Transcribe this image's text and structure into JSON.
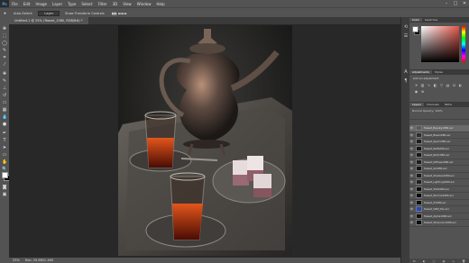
{
  "app": {
    "logo": "Ps"
  },
  "menu": [
    "File",
    "Edit",
    "Image",
    "Layer",
    "Type",
    "Select",
    "Filter",
    "3D",
    "View",
    "Window",
    "Help"
  ],
  "window_controls": [
    "–",
    "□",
    "✕"
  ],
  "options": {
    "tool": "Auto-Select:",
    "layer_value": "Layer",
    "show_transform": "Show Transform Controls"
  },
  "document": {
    "tab_title": "Untitled-1 @ 25% (Teaset_1080, RGB/8#) *"
  },
  "status": {
    "zoom": "25%",
    "doc_info": "Doc: 25.8M/1.16G"
  },
  "color_panel": {
    "tabs": [
      "Color",
      "Swatches"
    ],
    "fg": "#ffffff",
    "bg": "#000000",
    "accent": "#e2554a"
  },
  "adjustments": {
    "tabs": [
      "Adjustments",
      "Styles"
    ],
    "label": "Add an adjustment"
  },
  "layers_panel": {
    "tabs": [
      "Layers",
      "Channels",
      "Paths"
    ],
    "controls": "Normal   Opacity: 100%",
    "layers": [
      {
        "name": "Teaset_Beauty1080.exr",
        "thumb": "#5a5a5a",
        "selected": true
      },
      {
        "name": "Teaset_Base1080.exr",
        "thumb": "#2e2e2e",
        "selected": false
      },
      {
        "name": "Teaset_Spec1080.exr",
        "thumb": "#1f1f1f",
        "selected": false
      },
      {
        "name": "Teaset_Refl1080.exr",
        "thumb": "#181818",
        "selected": false
      },
      {
        "name": "Teaset_Refr1080.exr",
        "thumb": "#1a1a1a",
        "selected": false
      },
      {
        "name": "Teaset_Diffuse1080.exr",
        "thumb": "#202020",
        "selected": false
      },
      {
        "name": "Teaset_GI1080.exr",
        "thumb": "#161616",
        "selected": false
      },
      {
        "name": "Teaset_Shadow1080.exr",
        "thumb": "#1c1c1c",
        "selected": false
      },
      {
        "name": "Teaset_Lighting1080.exr",
        "thumb": "#222222",
        "selected": false
      },
      {
        "name": "Teaset_SSS1080.exr",
        "thumb": "#0e0e0e",
        "selected": false
      },
      {
        "name": "Teaset_Normal1080.exr",
        "thumb": "#0a0a0a",
        "selected": false
      },
      {
        "name": "Teaset_Z1080.exr",
        "thumb": "#0f0f0f",
        "selected": false
      },
      {
        "name": "Teaset_VRM_Tex.exr",
        "thumb": "#2244cc",
        "selected": false
      },
      {
        "name": "Teaset_Alpha1080.exr",
        "thumb": "#101010",
        "selected": false
      },
      {
        "name": "Teaset_Wirecolor1080.exr",
        "thumb": "#0d0d0d",
        "selected": false
      }
    ],
    "footer": [
      "fx",
      "◐",
      "▢",
      "▤",
      "+",
      "🗑"
    ]
  }
}
